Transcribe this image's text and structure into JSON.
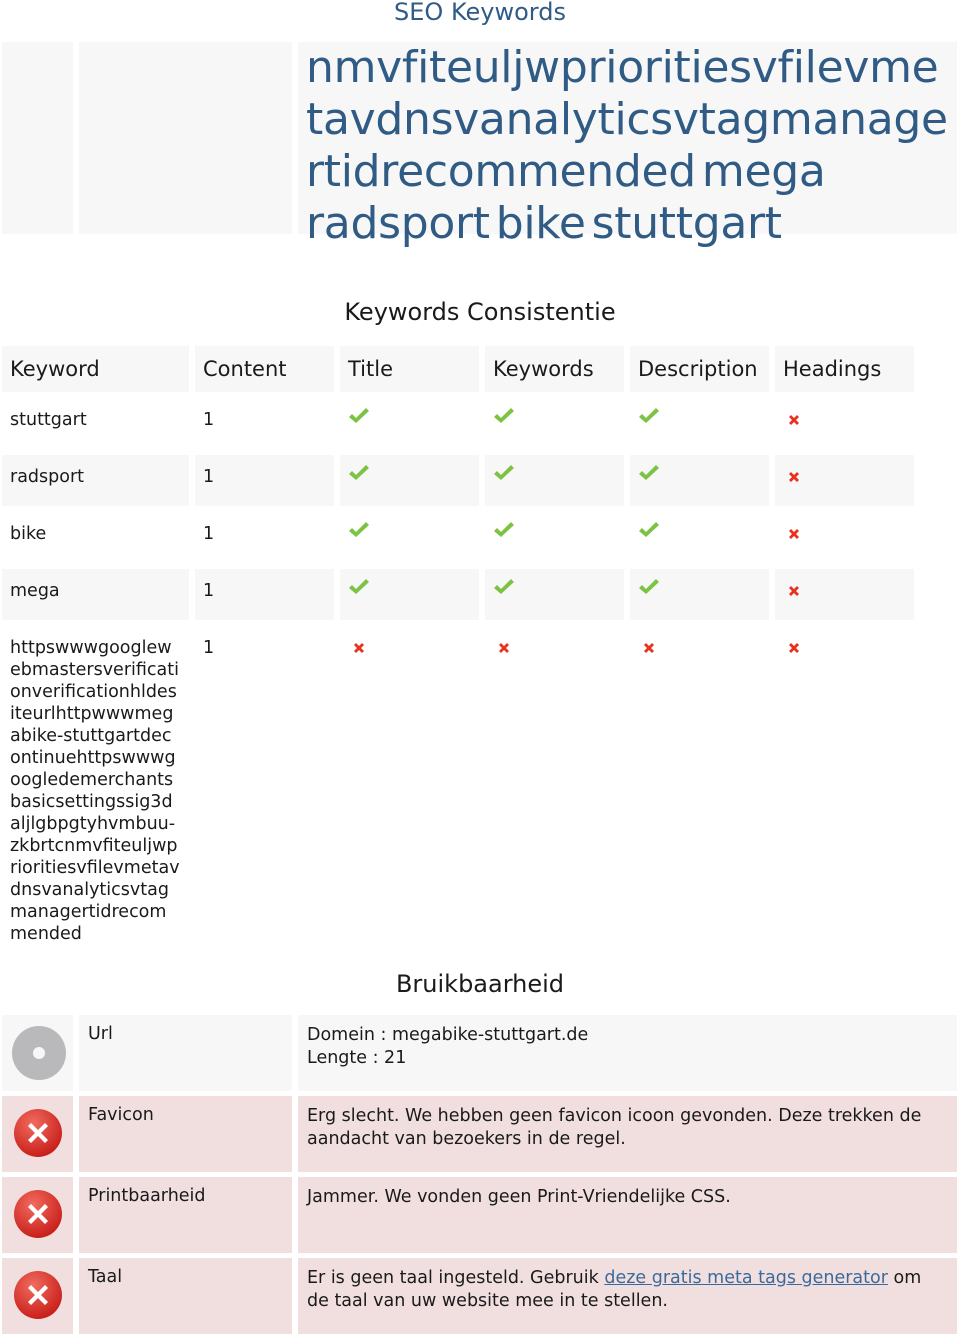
{
  "page": {
    "title": "SEO Keywords"
  },
  "keyword_cloud": {
    "words": [
      "nmvfiteuljwprioritiesvfilevmetavdnsvanalyticsvtagmanagertidrecommended",
      "mega",
      "radsport",
      "bike",
      "stuttgart"
    ],
    "color": "#2f5b85"
  },
  "consistency": {
    "title": "Keywords Consistentie",
    "headers": [
      "Keyword",
      "Content",
      "Title",
      "Keywords",
      "Description",
      "Headings"
    ],
    "rows": [
      {
        "keyword": "stuttgart",
        "content": "1",
        "title": true,
        "keywords": true,
        "description": true,
        "headings": false
      },
      {
        "keyword": "radsport",
        "content": "1",
        "title": true,
        "keywords": true,
        "description": true,
        "headings": false
      },
      {
        "keyword": "bike",
        "content": "1",
        "title": true,
        "keywords": true,
        "description": true,
        "headings": false
      },
      {
        "keyword": "mega",
        "content": "1",
        "title": true,
        "keywords": true,
        "description": true,
        "headings": false
      },
      {
        "keyword": "httpswwwgooglewebmastersverificationverificationhldesiteurlhttpwwwmegabike-stuttgartdecontinuehttpswwwgoogledemerchantsbasicsettingssig3daljlgbpgtyhvmbuu-zkbrtcnmvfiteuljwprioritiesvfilevmetavdnsvanalyticsvtagmanagertidrecommended",
        "content": "1",
        "title": false,
        "keywords": false,
        "description": false,
        "headings": false
      }
    ],
    "icons": {
      "pass": "check-icon",
      "fail": "cross-icon"
    },
    "colors": {
      "pass": "#7cc243",
      "fail": "#e8321f"
    }
  },
  "usability": {
    "title": "Bruikbaarheid",
    "rows": [
      {
        "status": "neutral",
        "icon": "neutral-disc-icon",
        "label": "Url",
        "lines": [
          "Domein : megabike-stuttgart.de",
          "Lengte : 21"
        ]
      },
      {
        "status": "bad",
        "icon": "error-circle-icon",
        "label": "Favicon",
        "text": "Erg slecht. We hebben geen favicon icoon gevonden. Deze trekken de aandacht van bezoekers in de regel."
      },
      {
        "status": "bad",
        "icon": "error-circle-icon",
        "label": "Printbaarheid",
        "text": "Jammer. We vonden geen Print-Vriendelijke CSS."
      },
      {
        "status": "bad",
        "icon": "error-circle-icon",
        "label": "Taal",
        "text_before": "Er is geen taal ingesteld. Gebruik ",
        "link": "deze gratis meta tags generator",
        "text_after": " om de taal van uw website mee in te stellen."
      }
    ],
    "colors": {
      "neutral_bg": "#f7f7f7",
      "bad_bg": "#f1dfe0",
      "link": "#3b6a9a"
    }
  }
}
